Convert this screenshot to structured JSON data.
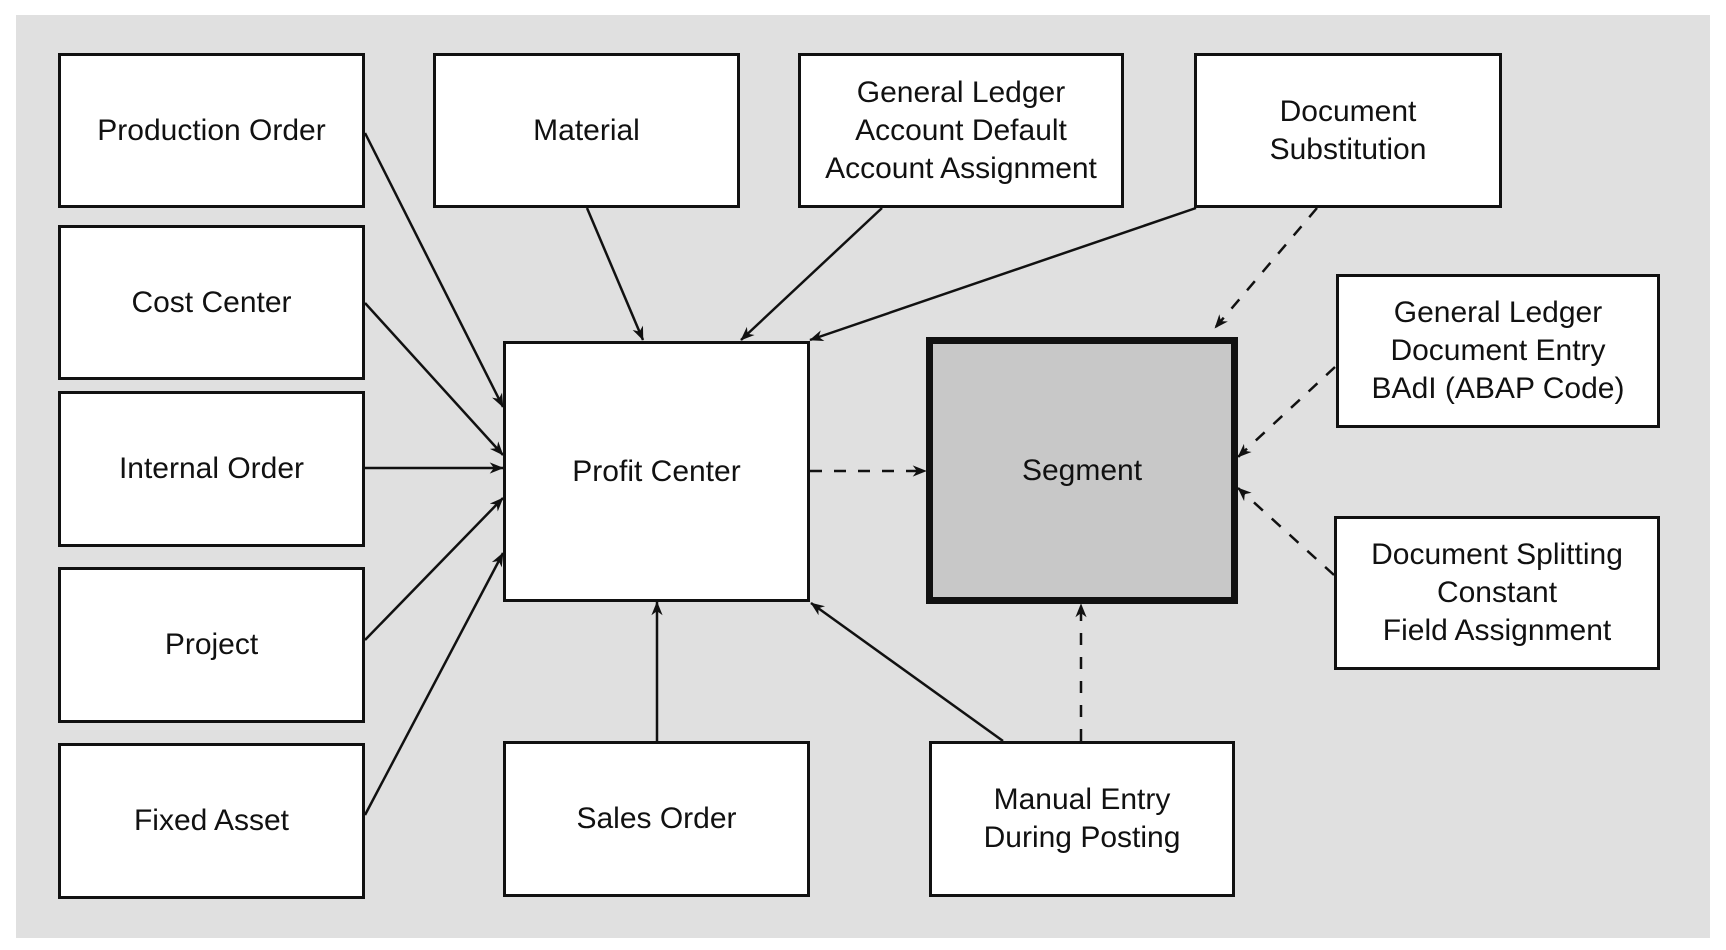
{
  "diagram": {
    "nodes": {
      "production_order": "Production Order",
      "cost_center": "Cost Center",
      "internal_order": "Internal Order",
      "project": "Project",
      "fixed_asset": "Fixed Asset",
      "material": "Material",
      "gl_account_default": "General Ledger\nAccount Default\nAccount Assignment",
      "document_substitution": "Document\nSubstitution",
      "profit_center": "Profit Center",
      "segment": "Segment",
      "gl_document_entry_badi": "General Ledger\nDocument Entry\nBAdI (ABAP Code)",
      "document_splitting": "Document Splitting\nConstant\nField Assignment",
      "sales_order": "Sales Order",
      "manual_entry": "Manual Entry\nDuring Posting"
    },
    "edges": [
      {
        "from": "production_order",
        "to": "profit_center",
        "style": "solid"
      },
      {
        "from": "cost_center",
        "to": "profit_center",
        "style": "solid"
      },
      {
        "from": "internal_order",
        "to": "profit_center",
        "style": "solid"
      },
      {
        "from": "project",
        "to": "profit_center",
        "style": "solid"
      },
      {
        "from": "fixed_asset",
        "to": "profit_center",
        "style": "solid"
      },
      {
        "from": "material",
        "to": "profit_center",
        "style": "solid"
      },
      {
        "from": "gl_account_default",
        "to": "profit_center",
        "style": "solid"
      },
      {
        "from": "document_substitution",
        "to": "profit_center",
        "style": "solid"
      },
      {
        "from": "sales_order",
        "to": "profit_center",
        "style": "solid"
      },
      {
        "from": "manual_entry",
        "to": "profit_center",
        "style": "solid"
      },
      {
        "from": "profit_center",
        "to": "segment",
        "style": "dashed"
      },
      {
        "from": "document_substitution",
        "to": "segment",
        "style": "dashed"
      },
      {
        "from": "gl_document_entry_badi",
        "to": "segment",
        "style": "dashed"
      },
      {
        "from": "document_splitting",
        "to": "segment",
        "style": "dashed"
      },
      {
        "from": "manual_entry",
        "to": "segment",
        "style": "dashed"
      }
    ],
    "colors": {
      "background": "#e0e0e0",
      "box_fill": "#ffffff",
      "segment_fill": "#c8c8c8",
      "stroke": "#111111"
    }
  }
}
